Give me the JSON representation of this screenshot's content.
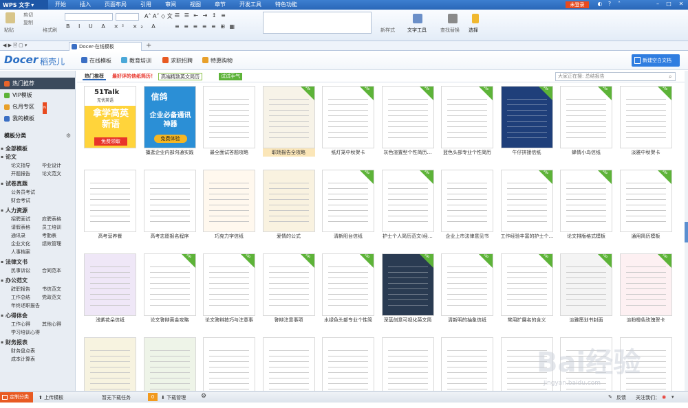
{
  "menubar": {
    "app_title": "WPS 文字",
    "tabs": [
      "开始",
      "插入",
      "页面布局",
      "引用",
      "审阅",
      "视图",
      "章节",
      "开发工具",
      "特色功能"
    ],
    "login": "未登录"
  },
  "ribbon": {
    "paste": "粘贴",
    "cut": "剪切",
    "copy": "复制",
    "format_painter": "格式刷",
    "new_style": "新样式",
    "text_tools": "文字工具",
    "find_replace": "查找替换",
    "select": "选择"
  },
  "doctab": {
    "title": "Docer-在线模板"
  },
  "header": {
    "logo": "Docer",
    "logo_cn": "稻壳儿",
    "nav": [
      "在线模板",
      "教育培训",
      "求职招聘",
      "特惠购物"
    ],
    "new_doc": "新建空白文档"
  },
  "sidebar": {
    "top": [
      {
        "label": "热门推荐",
        "color": "#e8642a"
      },
      {
        "label": "VIP模板",
        "color": "#5db338"
      },
      {
        "label": "包月专区",
        "color": "#e8a02a"
      },
      {
        "label": "我的模板",
        "color": "#3b6fc4"
      }
    ],
    "section": "模板分类",
    "all": "全部模板",
    "categories": [
      {
        "name": "论文",
        "subs": [
          "论文指导",
          "毕业设计",
          "开题报告",
          "论文范文"
        ]
      },
      {
        "name": "试卷真题",
        "subs": [
          "公务员考试",
          "财会考试"
        ]
      },
      {
        "name": "人力资源",
        "subs": [
          "招聘面试",
          "应聘表格",
          "请假表格",
          "员工培训",
          "通讯录",
          "考勤表",
          "企业文化",
          "绩效管理",
          "人事档案"
        ]
      },
      {
        "name": "法律文书",
        "subs": [
          "民事诉讼",
          "合同范本"
        ]
      },
      {
        "name": "办公范文",
        "subs": [
          "辞职报告",
          "书信范文",
          "工作总结",
          "党政范文",
          "年终述职报告"
        ]
      },
      {
        "name": "心得体会",
        "subs": [
          "工作心得",
          "其他心得",
          "学习培训心得"
        ]
      },
      {
        "name": "财务报表",
        "subs": [
          "财务盘点表",
          "成本计算表"
        ]
      }
    ]
  },
  "filter": {
    "tabs": [
      "热门推荐",
      "最好评的信纸简历！",
      "高端精致英文简历",
      "试试手气"
    ],
    "search_placeholder": "大家正在搜: 总结报告"
  },
  "templates": {
    "row1": [
      "",
      "擅逛企业内部沟通实践",
      "最全面试答题攻略",
      "职场报告全攻略",
      "纸灯笼中秋贺卡",
      "灰色渲置型个性简历…",
      "蓝色头部专业个性简历",
      "牛仔拼接信纸",
      "蜂情小鸟信纸",
      "淡雅中秋贺卡"
    ],
    "row2": [
      "高考营养餐",
      "高考志愿报名程序",
      "巧克力字信纸",
      "爱情的公式",
      "清新阳台信纸",
      "护士个人简历范文(经…",
      "企业上市法律意见书",
      "工作经验丰富的护士个…",
      "论文排版格式模板",
      "通用简历模板"
    ],
    "row3": [
      "浅紫花朵信纸",
      "论文答辩黄金攻略",
      "论文答辩技巧与注意事",
      "答辩注意事项",
      "水绿色头部专业个性简",
      "深蓝创意可视化英文简",
      "清新明的抽象信纸",
      "常用扩展名的含义",
      "淡雅策划书封面",
      "淡粉橙色玫瑰贺卡"
    ],
    "row4": [
      "",
      "",
      "",
      "",
      "",
      "",
      "",
      "",
      "",
      ""
    ],
    "vip": [
      [
        3,
        4,
        5,
        6,
        7,
        8,
        9
      ],
      [
        4,
        5,
        7,
        8,
        9
      ],
      [
        1,
        2,
        3,
        4,
        5,
        6,
        7,
        8,
        9
      ],
      []
    ],
    "banners": {
      "b1_brand": "51Talk",
      "b1_sub": "无忧英语",
      "b1_main": "拿学高英新语",
      "b1_btn": "免费领取",
      "b2_brand": "信鸽",
      "b2_main": "企业必备通讯神器",
      "b2_btn": "免费体验"
    }
  },
  "status": {
    "custom": "定制分类",
    "upload": "上传模板",
    "no_task": "暂无下载任务",
    "count": "0",
    "download_mgr": "下载管理",
    "feedback": "反馈",
    "follow": "关注我们："
  },
  "watermark": {
    "text": "Bai经验",
    "url": "jingyan.baidu.com"
  }
}
